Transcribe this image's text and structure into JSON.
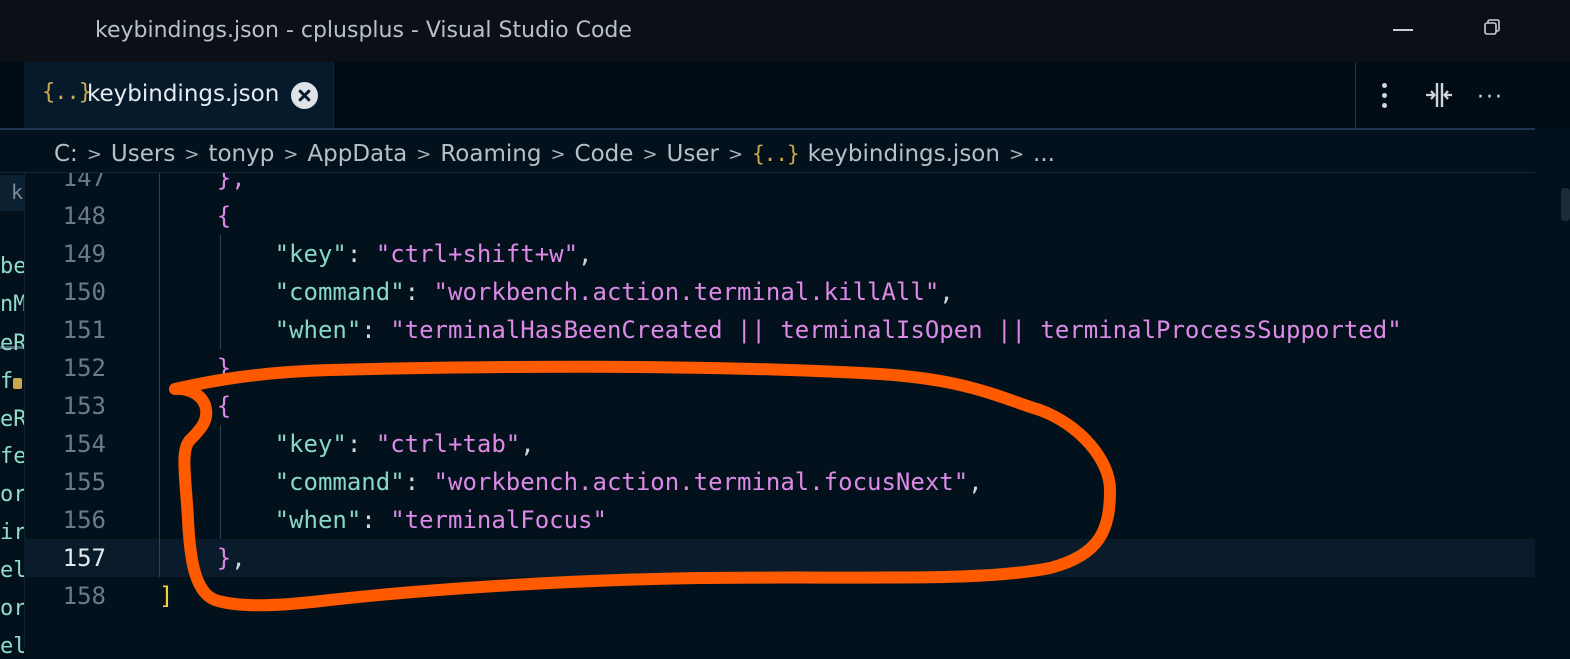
{
  "window": {
    "title": "keybindings.json - cplusplus - Visual Studio Code"
  },
  "tab": {
    "icon_glyph": "{..}",
    "label": "keybindings.json"
  },
  "breadcrumb": {
    "items": [
      "C:",
      "Users",
      "tonyp",
      "AppData",
      "Roaming",
      "Code",
      "User"
    ],
    "file_icon": "{..}",
    "file": "keybindings.json",
    "trailing": "..."
  },
  "sidebar": {
    "tab_letter": "k",
    "fragments": [
      "be",
      "nM",
      "eR",
      "f",
      "eR",
      "fe",
      "or",
      "ir",
      "el",
      "or",
      "el"
    ]
  },
  "editor": {
    "current_line": 157,
    "lines": [
      {
        "n": "147",
        "tokens": [
          {
            "t": "    },",
            "c": "b"
          }
        ]
      },
      {
        "n": "148",
        "tokens": [
          {
            "t": "    {",
            "c": "b"
          }
        ]
      },
      {
        "n": "149",
        "tokens": [
          {
            "t": "        ",
            "c": "p"
          },
          {
            "t": "\"key\"",
            "c": "k"
          },
          {
            "t": ": ",
            "c": "p"
          },
          {
            "t": "\"ctrl+shift+w\"",
            "c": "s"
          },
          {
            "t": ",",
            "c": "p"
          }
        ]
      },
      {
        "n": "150",
        "tokens": [
          {
            "t": "        ",
            "c": "p"
          },
          {
            "t": "\"command\"",
            "c": "k"
          },
          {
            "t": ": ",
            "c": "p"
          },
          {
            "t": "\"workbench.action.terminal.killAll\"",
            "c": "s"
          },
          {
            "t": ",",
            "c": "p"
          }
        ]
      },
      {
        "n": "151",
        "tokens": [
          {
            "t": "        ",
            "c": "p"
          },
          {
            "t": "\"when\"",
            "c": "k"
          },
          {
            "t": ": ",
            "c": "p"
          },
          {
            "t": "\"terminalHasBeenCreated || terminalIsOpen || terminalProcessSupported\"",
            "c": "s"
          }
        ]
      },
      {
        "n": "152",
        "tokens": [
          {
            "t": "    }",
            "c": "b"
          }
        ]
      },
      {
        "n": "153",
        "tokens": [
          {
            "t": "    {",
            "c": "b"
          }
        ]
      },
      {
        "n": "154",
        "tokens": [
          {
            "t": "        ",
            "c": "p"
          },
          {
            "t": "\"key\"",
            "c": "k"
          },
          {
            "t": ": ",
            "c": "p"
          },
          {
            "t": "\"ctrl+tab\"",
            "c": "s"
          },
          {
            "t": ",",
            "c": "p"
          }
        ]
      },
      {
        "n": "155",
        "tokens": [
          {
            "t": "        ",
            "c": "p"
          },
          {
            "t": "\"command\"",
            "c": "k"
          },
          {
            "t": ": ",
            "c": "p"
          },
          {
            "t": "\"workbench.action.terminal.focusNext\"",
            "c": "s"
          },
          {
            "t": ",",
            "c": "p"
          }
        ]
      },
      {
        "n": "156",
        "tokens": [
          {
            "t": "        ",
            "c": "p"
          },
          {
            "t": "\"when\"",
            "c": "k"
          },
          {
            "t": ": ",
            "c": "p"
          },
          {
            "t": "\"terminalFocus\"",
            "c": "s"
          }
        ]
      },
      {
        "n": "157",
        "tokens": [
          {
            "t": "    }",
            "c": "b"
          },
          {
            "t": ",",
            "c": "p"
          }
        ]
      },
      {
        "n": "158",
        "tokens": [
          {
            "t": "]",
            "c": "y"
          }
        ]
      }
    ]
  },
  "colors": {
    "annotation": "#ff5a00",
    "key": "#89d8c7",
    "string": "#dc8ae6",
    "bracket_outer": "#f0d33b"
  }
}
